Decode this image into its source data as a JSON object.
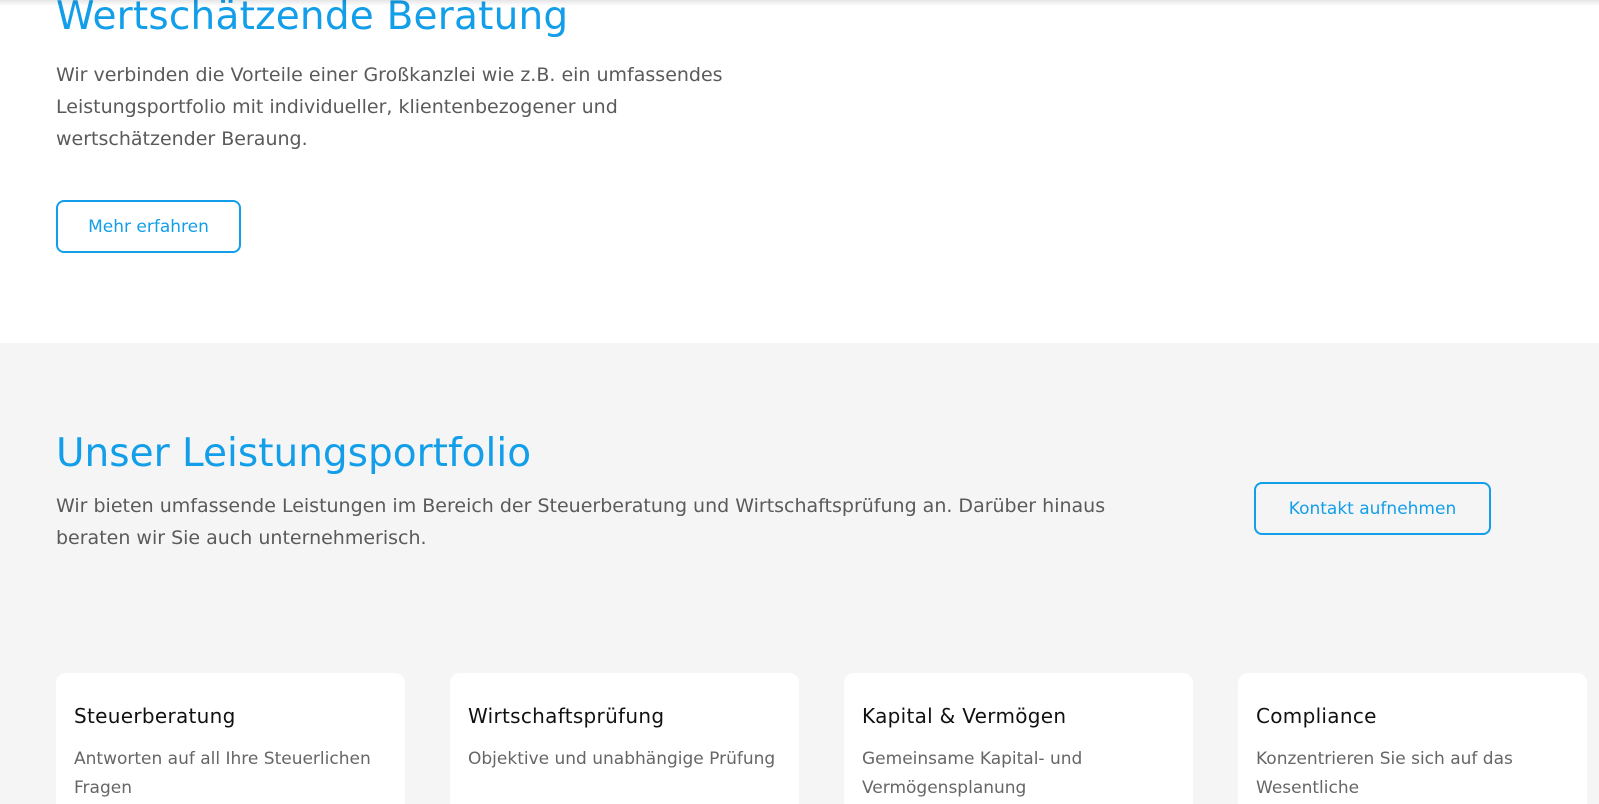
{
  "hero": {
    "title": "Wertschätzende Beratung",
    "text": "Wir verbinden die Vorteile einer Großkanzlei wie z.B. ein umfassendes Leistungsportfolio mit individueller, klientenbezogener und wertschätzender Beraung.",
    "button_label": "Mehr erfahren"
  },
  "portfolio": {
    "title": "Unser Leistungsportfolio",
    "text": "Wir bieten umfassende Leistungen im Bereich der Steuerberatung und Wirtschaftsprüfung an. Darüber hinaus beraten wir Sie auch unternehmerisch.",
    "button_label": "Kontakt aufnehmen",
    "cards": [
      {
        "title": "Steuerberatung",
        "text": "Antworten auf all Ihre Steuerlichen Fragen"
      },
      {
        "title": "Wirtschaftsprüfung",
        "text": "Objektive und unabhängige Prüfung"
      },
      {
        "title": "Kapital & Vermögen",
        "text": "Gemeinsame Kapital- und Vermögensplanung"
      },
      {
        "title": "Compliance",
        "text": "Konzentrieren Sie sich auf das Wesentliche"
      }
    ]
  },
  "colors": {
    "accent": "#139ee9",
    "section_bg": "#f5f5f5",
    "text": "#5a5a5a"
  }
}
